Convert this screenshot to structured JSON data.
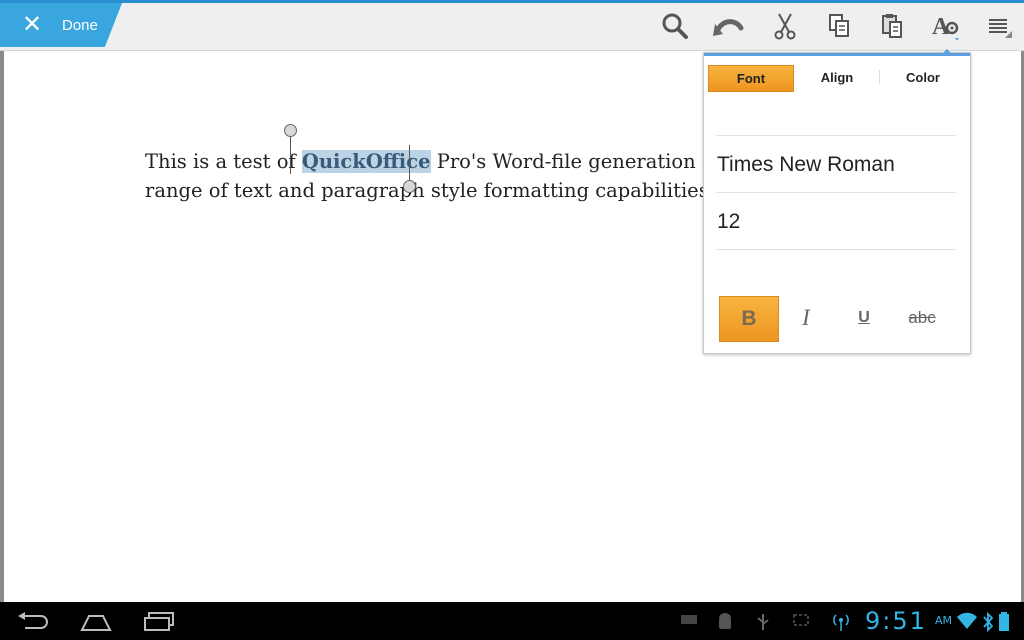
{
  "action_bar": {
    "close_glyph": "✕",
    "done_label": "Done",
    "icons": [
      "search-icon",
      "undo-icon",
      "cut-icon",
      "copy-icon",
      "paste-icon",
      "text-format-icon",
      "menu-icon"
    ]
  },
  "document": {
    "line1_before": "This is a test of ",
    "line1_selected": "QuickOffice",
    "line1_after": " Pro's Word-file generation cap",
    "line2": "range of text and paragraph style formatting capabilities."
  },
  "format_panel": {
    "tabs": [
      "Font",
      "Align",
      "Color"
    ],
    "active_tab": "Font",
    "font_name": "Times New Roman",
    "font_size": "12",
    "buttons": {
      "bold": "B",
      "italic": "I",
      "underline": "U",
      "strikethrough": "abc"
    },
    "bold_active": true
  },
  "status_bar": {
    "time": "9:51",
    "ampm": "AM"
  },
  "colors": {
    "accent_blue": "#39a6df",
    "active_orange": "#ee9521",
    "selection": "#bcd3e6",
    "clock": "#33b5e5"
  }
}
